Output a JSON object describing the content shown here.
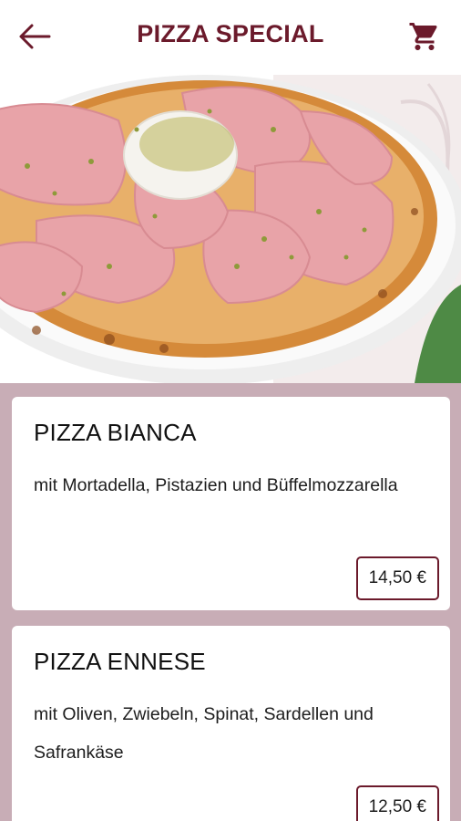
{
  "header": {
    "title": "PIZZA SPECIAL",
    "back_icon": "arrow-left-icon",
    "cart_icon": "shopping-cart-icon"
  },
  "hero": {
    "image": "pizza-bianca-photo"
  },
  "items": [
    {
      "name": "PIZZA BIANCA",
      "description": "mit Mortadella, Pistazien und Büffelmozzarella",
      "price": "14,50 €"
    },
    {
      "name": "PIZZA ENNESE",
      "description": "mit Oliven, Zwiebeln, Spinat, Sardellen und Safrankäse",
      "price": "12,50 €"
    }
  ],
  "colors": {
    "brand": "#6b1a2b",
    "list_background": "#c8adb6",
    "card": "#ffffff"
  }
}
